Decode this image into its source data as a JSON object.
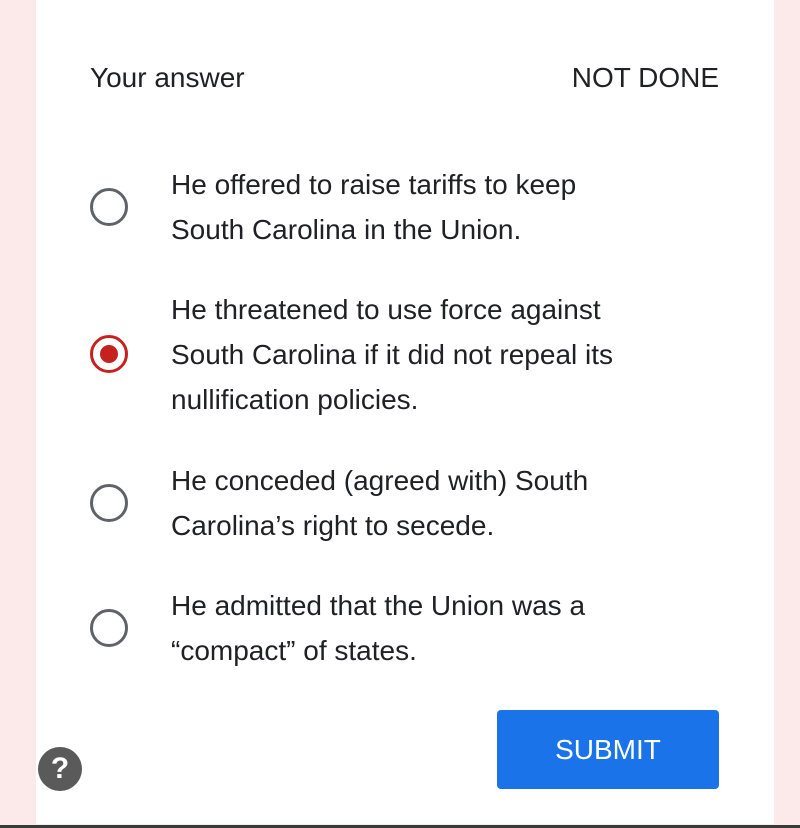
{
  "header": {
    "label": "Your answer",
    "status": "NOT DONE"
  },
  "options": [
    {
      "line1": "He offered to raise tariffs to keep",
      "line2": "South Carolina in the Union.",
      "selected": false
    },
    {
      "line1": "He threatened to use force against",
      "line2": "South Carolina if it did not repeal its",
      "line3": "nullification policies.",
      "selected": true
    },
    {
      "line1": "He conceded (agreed with) South",
      "line2": "Carolina’s right to secede.",
      "selected": false
    },
    {
      "line1": "He admitted that the Union was a",
      "line2": "“compact” of states.",
      "selected": false
    }
  ],
  "submit_label": "SUBMIT",
  "help_label": "?",
  "colors": {
    "accent": "#1a73e8",
    "selected": "#c5221f",
    "background": "#fceaea"
  },
  "icons": {
    "help": "help-icon",
    "radio": "radio-icon"
  }
}
